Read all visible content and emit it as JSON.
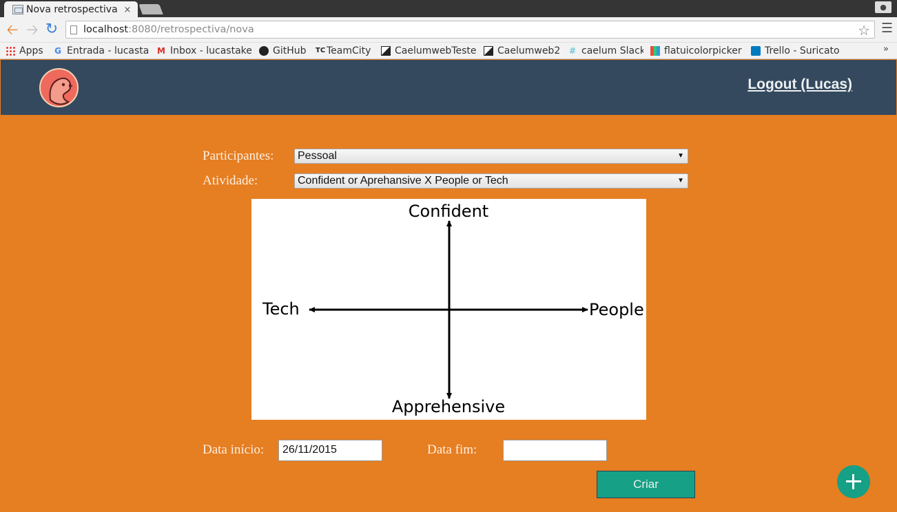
{
  "browser": {
    "tab_title": "Nova retrospectiva",
    "tab_close": "×",
    "url_host": "localhost",
    "url_path": ":8080/retrospectiva/nova",
    "bookmarks": [
      {
        "label": "Apps",
        "icon": "apps-grid-icon"
      },
      {
        "label": "Entrada - lucastal",
        "icon": "google-icon"
      },
      {
        "label": "Inbox - lucastakes",
        "icon": "gmail-icon"
      },
      {
        "label": "GitHub",
        "icon": "github-icon"
      },
      {
        "label": "TeamCity",
        "icon": "teamcity-icon"
      },
      {
        "label": "CaelumwebTeste",
        "icon": "caelum-icon"
      },
      {
        "label": "Caelumweb2",
        "icon": "caelum-icon"
      },
      {
        "label": "caelum Slack",
        "icon": "slack-icon"
      },
      {
        "label": "flatuicolorpicker",
        "icon": "colorpicker-icon"
      },
      {
        "label": "Trello - Suricato",
        "icon": "trello-icon"
      }
    ],
    "more": "»"
  },
  "header": {
    "logout_label": "Logout (Lucas)"
  },
  "form": {
    "participantes_label": "Participantes:",
    "participantes_value": "Pessoal",
    "atividade_label": "Atividade:",
    "atividade_value": "Confident or Aprehansive X People or Tech",
    "data_inicio_label": "Data início:",
    "data_inicio_value": "26/11/2015",
    "data_fim_label": "Data fim:",
    "data_fim_value": "",
    "submit_label": "Criar"
  },
  "diagram": {
    "top": "Confident",
    "bottom": "Apprehensive",
    "left": "Tech",
    "right": "People"
  },
  "colors": {
    "page_background": "#e67e22",
    "header_background": "#34495e",
    "button": "#16a085"
  }
}
